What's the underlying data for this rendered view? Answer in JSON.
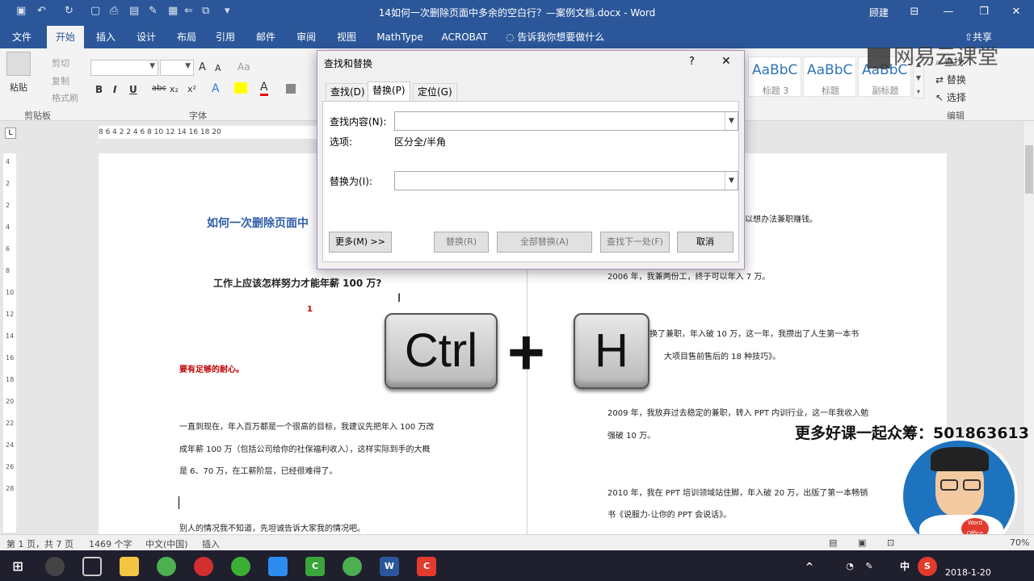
{
  "titlebar": {
    "title": "14如何一次删除页面中多余的空白行？—案例文档.docx  -  Word",
    "user": "顾建"
  },
  "tabs": [
    "文件",
    "开始",
    "插入",
    "设计",
    "布局",
    "引用",
    "邮件",
    "审阅",
    "视图",
    "MathType",
    "ACROBAT"
  ],
  "tellme": "告诉我你想要做什么",
  "share": "共享",
  "ribbon": {
    "clipboard": {
      "paste": "粘贴",
      "cut": "剪切",
      "copy": "复制",
      "format_painter": "格式刷",
      "group": "剪贴板"
    },
    "font": {
      "group": "字体",
      "bold": "B",
      "italic": "I",
      "underline": "U",
      "strike": "abc",
      "sub": "x₂",
      "sup": "x²",
      "grow": "A",
      "shrink": "A",
      "aa": "Aa",
      "font_color": "A"
    },
    "styles": [
      {
        "preview": "AaBbC",
        "name": "标题 3"
      },
      {
        "preview": "AaBbC",
        "name": "标题"
      },
      {
        "preview": "AaBbC",
        "name": "副标题"
      }
    ],
    "editing": {
      "find": "查找",
      "replace": "替换",
      "select": "选择",
      "group": "编辑"
    }
  },
  "ruler_text": "8  6  4  2     2  4  6  8  10  12  14  16  18  20",
  "vruler_text": [
    "4",
    "2",
    "2",
    "4",
    "6",
    "8",
    "10",
    "12",
    "14",
    "16",
    "18",
    "20",
    "22",
    "24",
    "26",
    "28"
  ],
  "doc": {
    "heading": "如何一次删除页面中",
    "subheading": "工作上应该怎样努力才能年薪 100 万?",
    "mark": "1",
    "red_line": "要有足够的耐心。",
    "para1": "一直到现在，年入百万都是一个很高的目标，我建议先把年入 100 万改",
    "para2": "成年薪 100 万（包括公司给你的社保福利收入），这样实际到手的大概",
    "para3": "是 6、70 万，在工薪阶层，已经很难得了。",
    "para4": "别人的情况我不知道，先坦诚告诉大家我的情况吧。",
    "right1": "所以想办法兼职赚钱。",
    "right2": "2006 年，我兼两份工，终于可以年入 7 万。",
    "right3": "换了兼职，年入破 10 万，这一年，我攒出了人生第一本书",
    "right4": "大项目售前售后的 18 种技巧》。",
    "right5": "2009 年，我放弃过去稳定的兼职，转入 PPT 内训行业，这一年我收入勉",
    "right6": "强破 10 万。",
    "right7": "2010 年，我在 PPT 培训领域站住脚，年入破 20 万，出版了第一本畅销",
    "right8": "书《说服力-让你的 PPT 会说话》。"
  },
  "dialog": {
    "title": "查找和替换",
    "help": "?",
    "close": "✕",
    "tabs": [
      "查找(D)",
      "替换(P)",
      "定位(G)"
    ],
    "find_label": "查找内容(N):",
    "options_label": "选项:",
    "options_value": "区分全/半角",
    "replace_label": "替换为(I):",
    "more": "更多(M) >>",
    "replace_btn": "替换(R)",
    "replace_all": "全部替换(A)",
    "find_next": "查找下一处(F)",
    "cancel": "取消"
  },
  "overlay": {
    "key1": "Ctrl",
    "plus": "+",
    "key2": "H"
  },
  "watermark": "网易云课堂",
  "promo": "更多好课一起众筹：501863613",
  "avatar_badge": "Word Office",
  "status": {
    "page": "第 1 页，共 7 页",
    "words": "1469 个字",
    "lang": "中文(中国)",
    "mode": "插入",
    "zoom": "70%"
  },
  "taskbar": {
    "ime": "中",
    "date": "2018-1-20"
  },
  "colors": {
    "word_blue": "#2b579a",
    "heading_blue": "#2e5ea8",
    "red_text": "#c00000"
  }
}
